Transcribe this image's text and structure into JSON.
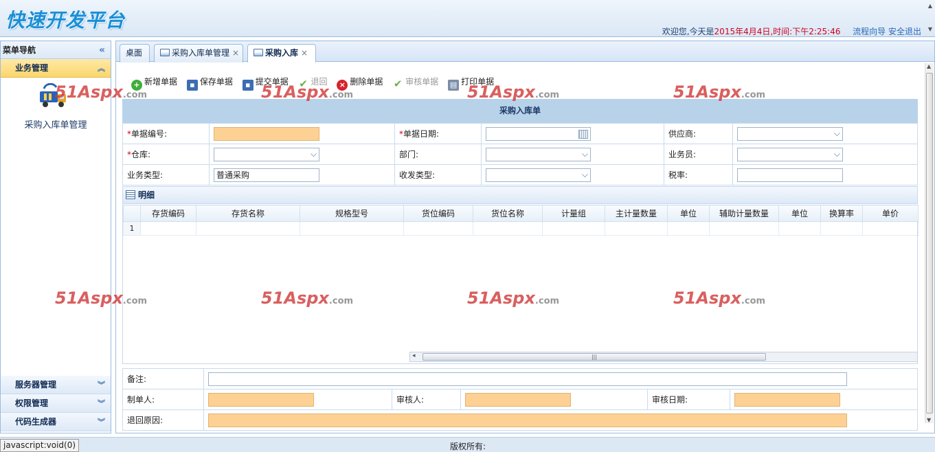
{
  "app": {
    "logo": "快速开发平台",
    "header": {
      "greeting_prefix": "欢迎您,今天是",
      "date_time": "2015年4月4日,时间:下午2:25:46",
      "process_guide": "流程向导",
      "logout": "安全退出"
    }
  },
  "sidebar": {
    "title": "菜单导航",
    "active_group": "业务管理",
    "module_label": "采购入库单管理",
    "bottom_groups": [
      "服务器管理",
      "权限管理",
      "代码生成器"
    ]
  },
  "tabs": [
    {
      "label": "桌面",
      "closable": false,
      "active": false
    },
    {
      "label": "采购入库单管理",
      "closable": true,
      "active": false
    },
    {
      "label": "采购入库",
      "closable": true,
      "active": true
    }
  ],
  "toolbar": [
    {
      "label": "新增单据",
      "icon": "add-icon",
      "enabled": true
    },
    {
      "label": "保存单据",
      "icon": "save-icon",
      "enabled": true
    },
    {
      "label": "提交单据",
      "icon": "submit-icon",
      "enabled": true
    },
    {
      "label": "退回",
      "icon": "return-icon",
      "enabled": false
    },
    {
      "label": "删除单据",
      "icon": "delete-icon",
      "enabled": true
    },
    {
      "label": "审核单据",
      "icon": "approve-icon",
      "enabled": false
    },
    {
      "label": "打印单据",
      "icon": "print-icon",
      "enabled": true
    }
  ],
  "form": {
    "caption": "采购入库单",
    "fields": {
      "doc_no": {
        "label": "单据编号:",
        "value": ""
      },
      "doc_date": {
        "label": "单据日期:",
        "value": ""
      },
      "supplier": {
        "label": "供应商:",
        "value": ""
      },
      "warehouse": {
        "label": "仓库:",
        "value": ""
      },
      "department": {
        "label": "部门:",
        "value": ""
      },
      "salesman": {
        "label": "业务员:",
        "value": ""
      },
      "biz_type": {
        "label": "业务类型:",
        "value": "普通采购"
      },
      "io_type": {
        "label": "收发类型:",
        "value": ""
      },
      "tax_rate": {
        "label": "税率:",
        "value": ""
      }
    }
  },
  "detail": {
    "title": "明细",
    "columns": [
      "存货编码",
      "存货名称",
      "规格型号",
      "货位编码",
      "货位名称",
      "计量组",
      "主计量数量",
      "单位",
      "辅助计量数量",
      "单位",
      "换算率",
      "单价"
    ],
    "rows": [
      [
        "1"
      ]
    ]
  },
  "footer_form": {
    "remark": {
      "label": "备注:",
      "value": ""
    },
    "creator": {
      "label": "制单人:",
      "value": ""
    },
    "auditor": {
      "label": "审核人:",
      "value": ""
    },
    "audit_date": {
      "label": "审核日期:",
      "value": ""
    },
    "return_reason": {
      "label": "退回原因:",
      "value": ""
    }
  },
  "watermark": {
    "brand": "51Aspx",
    "suffix": ".com"
  },
  "statusbar": {
    "link_text": "javascript:void(0)",
    "copyright": "版权所有:"
  }
}
